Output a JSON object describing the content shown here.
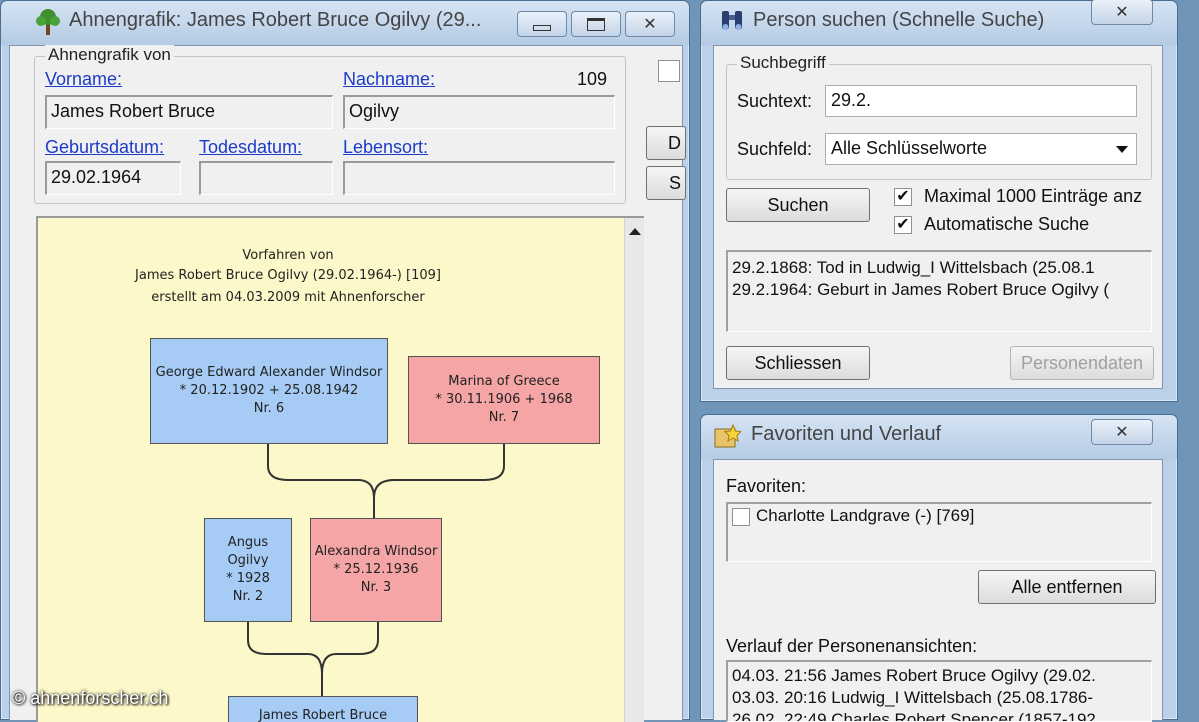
{
  "main_window": {
    "title": "Ahnengrafik: James Robert Bruce Ogilvy (29...",
    "group_title": "Ahnengrafik von",
    "vorname_label": "Vorname:",
    "nachname_label": "Nachname:",
    "person_number": "109",
    "vorname_value": "James Robert Bruce",
    "nachname_value": "Ogilvy",
    "geburtsdatum_label": "Geburtsdatum:",
    "todesdatum_label": "Todesdatum:",
    "lebensort_label": "Lebensort:",
    "geburtsdatum_value": "29.02.1964",
    "todesdatum_value": "",
    "lebensort_value": "",
    "side_btn_1": "D",
    "side_btn_2": "S"
  },
  "tree": {
    "header_line1": "Vorfahren von",
    "header_line2": "James Robert Bruce Ogilvy (29.02.1964-) [109]",
    "header_line3": "erstellt am 04.03.2009 mit Ahnenforscher",
    "persons": {
      "p6": {
        "name": "George Edward Alexander Windsor",
        "dates": "* 20.12.1902 + 25.08.1942",
        "nr": "Nr. 6"
      },
      "p7": {
        "name": "Marina of  Greece",
        "dates": "* 30.11.1906 + 1968",
        "nr": "Nr. 7"
      },
      "p2": {
        "name": "Angus Ogilvy",
        "dates": "* 1928",
        "nr": "Nr. 2"
      },
      "p3": {
        "name": "Alexandra Windsor",
        "dates": "* 25.12.1936",
        "nr": "Nr. 3"
      },
      "p1": {
        "name": "James Robert Bruce"
      }
    }
  },
  "search_window": {
    "title": "Person suchen (Schnelle Suche)",
    "group_title": "Suchbegriff",
    "suchtext_label": "Suchtext:",
    "suchtext_value": "29.2.",
    "suchfeld_label": "Suchfeld:",
    "suchfeld_value": "Alle Schlüsselworte",
    "search_button": "Suchen",
    "max_checkbox_label": "Maximal 1000 Einträge anz",
    "auto_checkbox_label": "Automatische Suche",
    "results": [
      "29.2.1868: Tod in Ludwig_I Wittelsbach (25.08.1",
      "29.2.1964: Geburt in James Robert Bruce Ogilvy ("
    ],
    "close_button": "Schliessen",
    "personendaten_button": "Personendaten"
  },
  "favorites_window": {
    "title": "Favoriten und Verlauf",
    "favorites_label": "Favoriten:",
    "favorites": [
      "Charlotte Landgrave (-) [769]"
    ],
    "remove_all_button": "Alle entfernen",
    "history_label": "Verlauf der Personenansichten:",
    "history": [
      "04.03. 21:56  James Robert Bruce Ogilvy (29.02.",
      "03.03. 20:16  Ludwig_I Wittelsbach (25.08.1786-",
      "26.02. 22:49  Charles Robert Spencer (1857-192"
    ]
  },
  "watermark": "© ahnenforscher.ch",
  "colors": {
    "male_box": "#a6ccf5",
    "female_box": "#f5a5a5",
    "chart_background": "#fcf8c9",
    "label_blue": "#1c3cc8"
  }
}
